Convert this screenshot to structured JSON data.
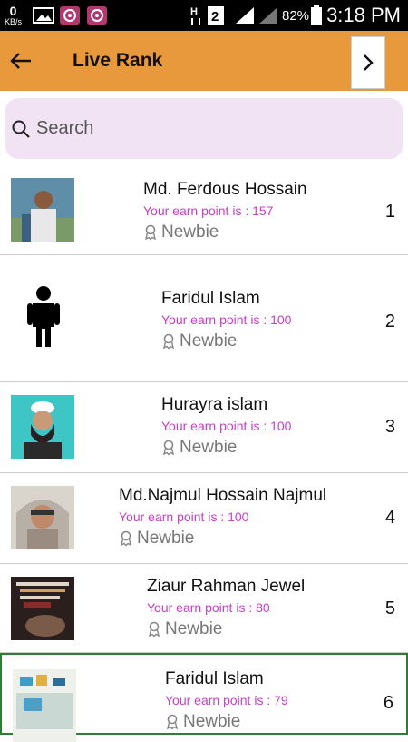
{
  "status_bar": {
    "net_speed": "0",
    "net_unit": "KB/s",
    "battery": "82%",
    "time": "3:18 PM"
  },
  "app_bar": {
    "title": "Live Rank",
    "back_icon": "arrow-left-icon",
    "next_icon": "chevron-right-icon",
    "color": "#e8993c"
  },
  "search": {
    "placeholder": "Search"
  },
  "earn_prefix": "Your earn point is : ",
  "ranks": [
    {
      "name": "Md. Ferdous Hossain",
      "points": "Your earn point is : 157",
      "level": "Newbie",
      "rank": "1"
    },
    {
      "name": "Faridul Islam",
      "points": "Your earn point is : 100",
      "level": "Newbie",
      "rank": "2"
    },
    {
      "name": "Hurayra islam",
      "points": "Your earn point is : 100",
      "level": "Newbie",
      "rank": "3"
    },
    {
      "name": "Md.Najmul Hossain Najmul",
      "points": "Your earn point is : 100",
      "level": "Newbie",
      "rank": "4"
    },
    {
      "name": "Ziaur Rahman Jewel",
      "points": "Your earn point is : 80",
      "level": "Newbie",
      "rank": "5"
    },
    {
      "name": "Faridul Islam",
      "points": "Your earn point is : 79",
      "level": "Newbie",
      "rank": "6"
    }
  ]
}
